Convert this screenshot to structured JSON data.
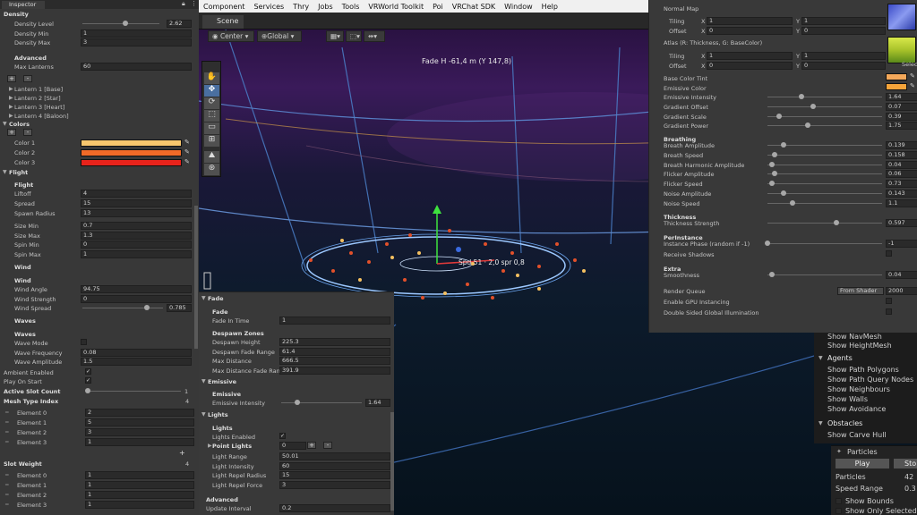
{
  "menu": [
    "Component",
    "Services",
    "Thry",
    "Jobs",
    "Tools",
    "VRWorld Toolkit",
    "Poi",
    "VRChat SDK",
    "Window",
    "Help"
  ],
  "inspector": {
    "tab": "Inspector",
    "density": {
      "title": "Density",
      "rows": [
        [
          "Density Level",
          "2.62"
        ],
        [
          "Density Min",
          "1"
        ],
        [
          "Density Max",
          "3"
        ]
      ]
    },
    "advanced": {
      "title": "Advanced",
      "max_lanterns_label": "Max Lanterns",
      "max_lanterns": "60"
    },
    "lanterns": [
      "Lantern 1 [Base]",
      "Lantern 2 [Star]",
      "Lantern 3 [Heart]",
      "Lantern 4 [Baloon]"
    ],
    "colors": {
      "title": "Colors",
      "items": [
        [
          "Color 1",
          "#f7c76e"
        ],
        [
          "Color 2",
          "#f06a28"
        ],
        [
          "Color 3",
          "#e8231b"
        ]
      ]
    },
    "flight_fold": "Flight",
    "flight": {
      "title": "Flight",
      "rows": [
        [
          "Liftoff",
          "4"
        ],
        [
          "Spread",
          "15"
        ],
        [
          "Spawn Radius",
          "13"
        ]
      ]
    },
    "size": [
      [
        "Size Min",
        "0.7"
      ],
      [
        "Size Max",
        "1.3"
      ],
      [
        "Spin Min",
        "0"
      ],
      [
        "Spin Max",
        "1"
      ]
    ],
    "wind_fold": "Wind",
    "wind": {
      "title": "Wind",
      "rows": [
        [
          "Wind Angle",
          "94.75"
        ],
        [
          "Wind Strength",
          "0"
        ]
      ],
      "spread_label": "Wind Spread",
      "spread": "0.785"
    },
    "waves_fold": "Waves",
    "waves": {
      "title": "Waves",
      "mode": "Wave Mode",
      "rows": [
        [
          "Wave Frequency",
          "0.08"
        ],
        [
          "Wave Amplitude",
          "1.5"
        ]
      ]
    },
    "ambient": "Ambient Enabled",
    "play_on_start": "Play On Start",
    "active_slot_count": "Active Slot Count",
    "active_slot_value": "1",
    "mesh_type_index": "Mesh Type Index",
    "mesh_type_count": "4",
    "mesh_elements": [
      [
        "Element 0",
        "2"
      ],
      [
        "Element 1",
        "5"
      ],
      [
        "Element 2",
        "3"
      ],
      [
        "Element 3",
        "1"
      ]
    ],
    "slot_weight": "Slot Weight",
    "slot_weight_count": "4",
    "slot_elements": [
      [
        "Element 0",
        "1"
      ],
      [
        "Element 1",
        "1"
      ],
      [
        "Element 2",
        "1"
      ],
      [
        "Element 3",
        "1"
      ]
    ]
  },
  "scene": {
    "tab": "Scene",
    "pivot": "Center",
    "space": "Global",
    "overlay_text": "Fade H -61,4 m (Y 147,8)",
    "gizmo_text": "Spd 51 · 2,0 spr 0,8"
  },
  "fade_panel": {
    "title": "Fade",
    "fade": {
      "title": "Fade",
      "rows": [
        [
          "Fade In Time",
          "1"
        ]
      ]
    },
    "despawn": {
      "title": "Despawn Zones",
      "rows": [
        [
          "Despawn Height",
          "225.3"
        ],
        [
          "Despawn Fade Range",
          "61.4"
        ],
        [
          "Max Distance",
          "666.5"
        ],
        [
          "Max Distance Fade Rang",
          "391.9"
        ]
      ]
    },
    "emissive_fold": "Emissive",
    "emissive": {
      "title": "Emissive",
      "label": "Emissive Intensity",
      "value": "1.64"
    },
    "lights_fold": "Lights",
    "lights": {
      "title": "Lights",
      "enabled": "Lights Enabled",
      "point": "Point Lights",
      "point_value": "0",
      "rows": [
        [
          "Light Range",
          "50.01"
        ],
        [
          "Light Intensity",
          "60"
        ],
        [
          "Light Repel Radius",
          "15"
        ],
        [
          "Light Repel Force",
          "3"
        ]
      ]
    },
    "advanced": {
      "title": "Advanced",
      "label": "Update Interval",
      "value": "0.2"
    }
  },
  "material": {
    "normal_map": "Normal Map",
    "tiling": "Tiling",
    "offset": "Offset",
    "tile1": [
      "1",
      "1"
    ],
    "off1": [
      "0",
      "0"
    ],
    "atlas": "Atlas (R: Thickness, G: BaseColor)",
    "tile2": [
      "1",
      "1"
    ],
    "off2": [
      "0",
      "0"
    ],
    "select": "Select",
    "base_tint": "Base Color Tint",
    "emissive_color": "Emissive Color",
    "sliders": [
      [
        "Emissive Intensity",
        "1.64",
        0.3
      ],
      [
        "Gradient Offset",
        "0.07",
        0.4
      ],
      [
        "Gradient Scale",
        "0.39",
        0.1
      ],
      [
        "Gradient Power",
        "1.75",
        0.35
      ]
    ],
    "breathing": "Breathing",
    "breath_sliders": [
      [
        "Breath Amplitude",
        "0.139",
        0.14
      ],
      [
        "Breath Speed",
        "0.158",
        0.06
      ],
      [
        "Breath Harmonic Amplitude",
        "0.04",
        0.04
      ],
      [
        "Flicker Amplitude",
        "0.06",
        0.06
      ],
      [
        "Flicker Speed",
        "0.73",
        0.04
      ],
      [
        "Noise Amplitude",
        "0.143",
        0.14
      ],
      [
        "Noise Speed",
        "1.1",
        0.22
      ]
    ],
    "thickness": "Thickness",
    "thickness_slider": [
      "Thickness Strength",
      "0.597",
      0.6
    ],
    "per_instance": "PerInstance",
    "instance_phase": [
      "Instance Phase (random if -1)",
      "-1",
      0.0
    ],
    "receive_shadows": "Receive Shadows",
    "extra": "Extra",
    "smoothness": [
      "Smoothness",
      "0.04",
      0.04
    ],
    "render_queue": "Render Queue",
    "render_queue_mode": "From Shader",
    "render_queue_value": "2000",
    "gpu_instancing": "Enable GPU Instancing",
    "double_sided": "Double Sided Global Illumination"
  },
  "navmesh": {
    "items": [
      "Show NavMesh",
      "Show HeightMesh"
    ],
    "agents": "Agents",
    "agent_items": [
      "Show Path Polygons",
      "Show Path Query Nodes",
      "Show Neighbours",
      "Show Walls",
      "Show Avoidance"
    ],
    "obstacles": "Obstacles",
    "obstacle_items": [
      "Show Carve Hull"
    ]
  },
  "particles": {
    "title": "Particles",
    "play": "Play",
    "stop": "Sto",
    "rows": [
      [
        "Particles",
        "42"
      ],
      [
        "Speed Range",
        "0.3"
      ]
    ],
    "checks": [
      "Show Bounds",
      "Show Only Selected"
    ]
  }
}
